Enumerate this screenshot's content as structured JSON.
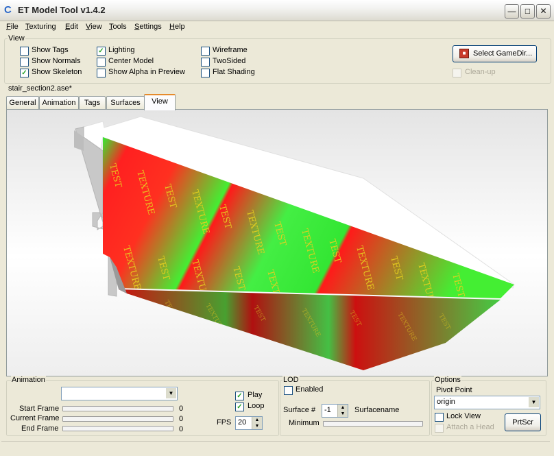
{
  "window": {
    "title": "ET Model Tool v1.4.2"
  },
  "menu": [
    "File",
    "Texturing",
    "Edit",
    "View",
    "Tools",
    "Settings",
    "Help"
  ],
  "view_group": {
    "title": "View",
    "options": [
      {
        "label": "Show Tags",
        "checked": false
      },
      {
        "label": "Show Normals",
        "checked": false
      },
      {
        "label": "Show Skeleton",
        "checked": true
      },
      {
        "label": "Lighting",
        "checked": true
      },
      {
        "label": "Center Model",
        "checked": false
      },
      {
        "label": "Show Alpha in Preview",
        "checked": false
      },
      {
        "label": "Wireframe",
        "checked": false
      },
      {
        "label": "TwoSided",
        "checked": false
      },
      {
        "label": "Flat Shading",
        "checked": false
      }
    ],
    "select_gamedir": "Select GameDir...",
    "cleanup": {
      "label": "Clean-up",
      "checked": false,
      "enabled": false
    }
  },
  "file_label": "stair_section2.ase*",
  "tabs": [
    {
      "label": "General",
      "active": false
    },
    {
      "label": "Animation",
      "active": false
    },
    {
      "label": "Tags",
      "active": false
    },
    {
      "label": "Surfaces",
      "active": false
    },
    {
      "label": "View",
      "active": true
    }
  ],
  "viewport": {
    "texture_text": "TEST TEXTURE",
    "colors": {
      "red": "#ff2020",
      "green": "#33ee33",
      "face": "#ffffff"
    }
  },
  "animation": {
    "title": "Animation",
    "selected": "",
    "start_frame": {
      "label": "Start Frame",
      "value": "0"
    },
    "current_frame": {
      "label": "Current Frame",
      "value": "0"
    },
    "end_frame": {
      "label": "End Frame",
      "value": "0"
    },
    "play": {
      "label": "Play",
      "checked": true
    },
    "loop": {
      "label": "Loop",
      "checked": true
    },
    "fps": {
      "label": "FPS",
      "value": "20"
    }
  },
  "lod": {
    "title": "LOD",
    "enabled": {
      "label": "Enabled",
      "checked": false
    },
    "surface_label": "Surface #",
    "surface_value": "-1",
    "surfacename_label": "Surfacename",
    "minimum_label": "Minimum"
  },
  "options": {
    "title": "Options",
    "pivot_label": "Pivot Point",
    "pivot_value": "origin",
    "lock_view": {
      "label": "Lock View",
      "checked": false
    },
    "attach_head": {
      "label": "Attach a Head",
      "checked": false,
      "enabled": false
    },
    "prtscr": "PrtScr"
  }
}
